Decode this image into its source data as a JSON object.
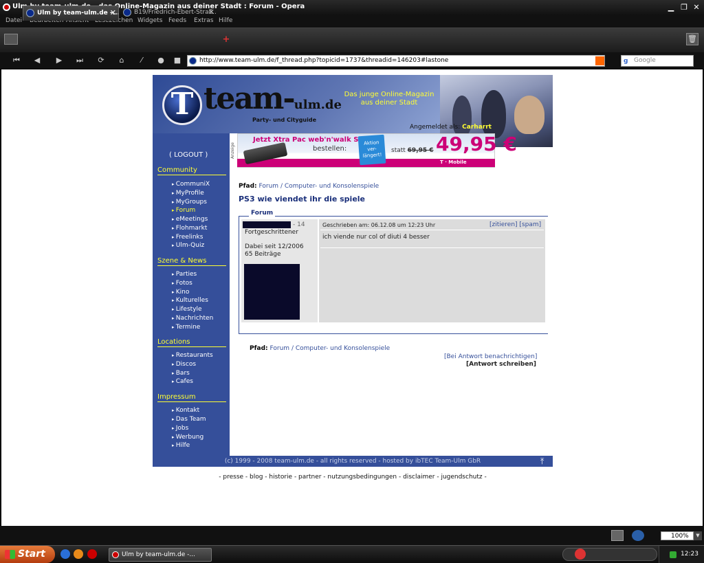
{
  "window": {
    "title": "Ulm by team-ulm.de - das Online-Magazin aus deiner Stadt : Forum - Opera"
  },
  "menu": [
    "Datei",
    "Bearbeiten",
    "Ansicht",
    "Lesezeichen",
    "Widgets",
    "Feeds",
    "Extras",
    "Hilfe"
  ],
  "tabs": [
    {
      "label": "Ulm by team-ulm.de -...",
      "active": true
    },
    {
      "label": "B19/Friedrich-Ebert-Straß...",
      "active": false
    }
  ],
  "address": {
    "url": "http://www.team-ulm.de/f_thread.php?topicid=1737&threadid=146203#lastone",
    "search_placeholder": "Google"
  },
  "site": {
    "logo": {
      "letter": "T",
      "name": "team-",
      "name_suffix": "ulm.de",
      "tagline": "Party- und Cityguide"
    },
    "slogan_line1": "Das junge Online-Magazin",
    "slogan_line2": "aus deiner Stadt",
    "logged_in_label": "Angemeldet als:",
    "logged_in_user": "Carharrt",
    "ad": {
      "label": "Anzeige",
      "line1_prefix": "Jetzt ",
      "line1_highlight": "Xtra Pac web'n'walk Stick",
      "line2": "bestellen:",
      "badge": [
        "Aktion",
        "ver-",
        "längert!"
      ],
      "statt_label": "statt",
      "old_price": "69,95 €",
      "price": "49,95 €",
      "brand": "T · Mobile"
    },
    "sidebar": {
      "logout": "( LOGOUT )",
      "sections": [
        {
          "title": "Community",
          "items": [
            "CommuniX",
            "MyProfile",
            "MyGroups",
            "Forum",
            "eMeetings",
            "Flohmarkt",
            "Freelinks",
            "Ulm-Quiz"
          ]
        },
        {
          "title": "Szene & News",
          "items": [
            "Parties",
            "Fotos",
            "Kino",
            "Kulturelles",
            "Lifestyle",
            "Nachrichten",
            "Termine"
          ]
        },
        {
          "title": "Locations",
          "items": [
            "Restaurants",
            "Discos",
            "Bars",
            "Cafes"
          ]
        },
        {
          "title": "Impressum",
          "items": [
            "Kontakt",
            "Das Team",
            "Jobs",
            "Werbung",
            "Hilfe"
          ]
        }
      ]
    },
    "path": {
      "label": "Pfad:",
      "parts": [
        "Forum",
        "/",
        "Computer- und Konsolenspiele"
      ]
    },
    "thread_title": "PS3 wie viendet ihr die spiele",
    "forum_legend": "Forum",
    "post": {
      "user_count": "- 14",
      "rank": "Fortgeschrittener",
      "since": "Dabei seit 12/2006",
      "posts": "65 Beiträge",
      "meta": "Geschrieben am: 06.12.08 um 12:23 Uhr",
      "actions": "[zitieren] [spam]",
      "text": "ich viende nur col of diuti 4 besser"
    },
    "notify": "[Bei Antwort benachrichtigen]",
    "reply": "[Antwort schreiben]",
    "footer": "(c) 1999 - 2008 team-ulm.de - all rights reserved - hosted by ibTEC Team-Ulm GbR",
    "footer_links": "- presse - blog - historie - partner - nutzungsbedingungen - disclaimer - jugendschutz -"
  },
  "status": {
    "zoom": "100%"
  },
  "taskbar": {
    "start": "Start",
    "task": "Ulm by team-ulm.de -...",
    "clock": "12:23"
  },
  "colors": {
    "site_blue": "#354f9a",
    "accent_yellow": "#ffff33",
    "ad_pink": "#cc0077"
  }
}
